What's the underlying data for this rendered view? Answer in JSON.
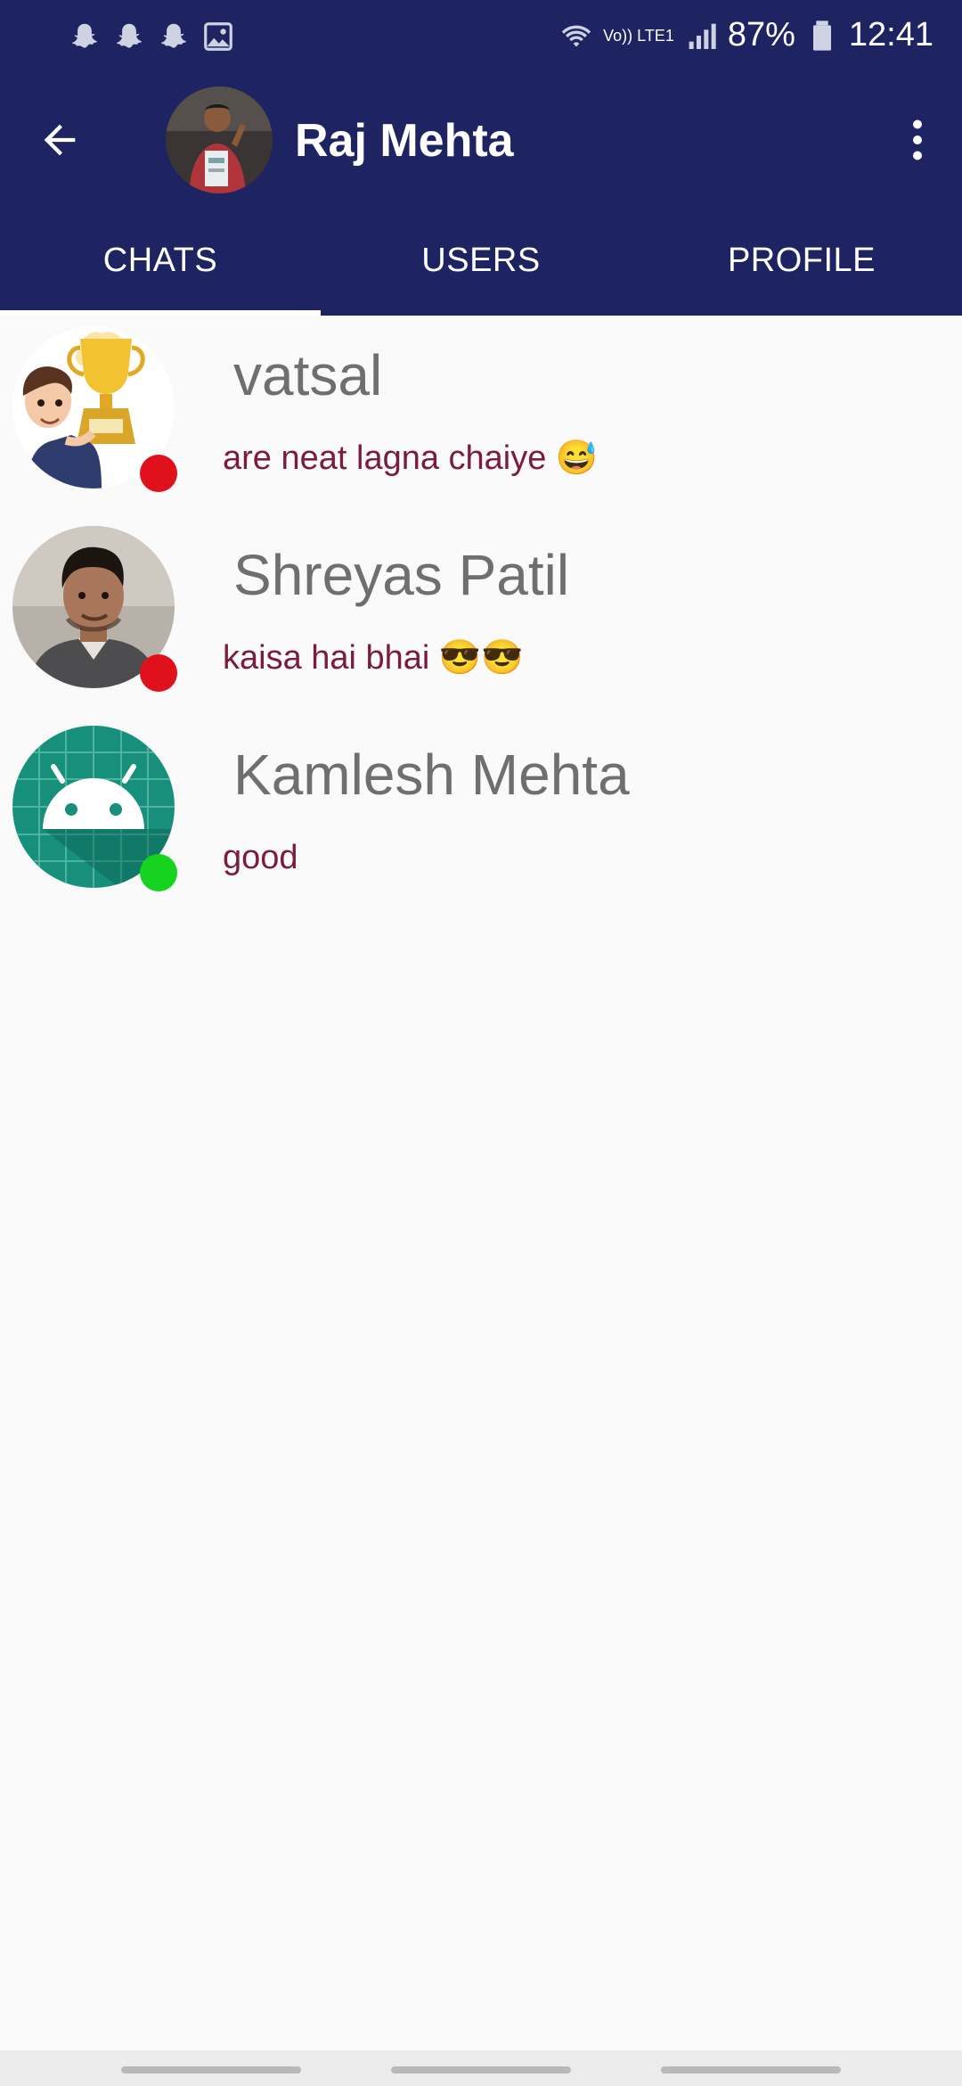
{
  "status_bar": {
    "battery": "87%",
    "time": "12:41",
    "network_label": "Vo)) LTE1",
    "left_icons": [
      "snapchat-icon",
      "snapchat-icon",
      "snapchat-icon",
      "gallery-icon"
    ]
  },
  "toolbar": {
    "title": "Raj Mehta"
  },
  "tabs": [
    {
      "label": "CHATS",
      "selected": true
    },
    {
      "label": "USERS",
      "selected": false
    },
    {
      "label": "PROFILE",
      "selected": false
    }
  ],
  "chats": [
    {
      "name": "vatsal",
      "last_message": "are neat lagna chaiye 😅",
      "status": "offline",
      "status_color": "#e0111b"
    },
    {
      "name": "Shreyas Patil",
      "last_message": "kaisa hai bhai 😎😎",
      "status": "offline",
      "status_color": "#e0111b"
    },
    {
      "name": "Kamlesh Mehta",
      "last_message": "good",
      "status": "online",
      "status_color": "#16d320"
    }
  ],
  "colors": {
    "header": "#1e2462",
    "name_text": "#6f6f6f",
    "message_text": "#7a1b3f",
    "background": "#fafafa"
  }
}
